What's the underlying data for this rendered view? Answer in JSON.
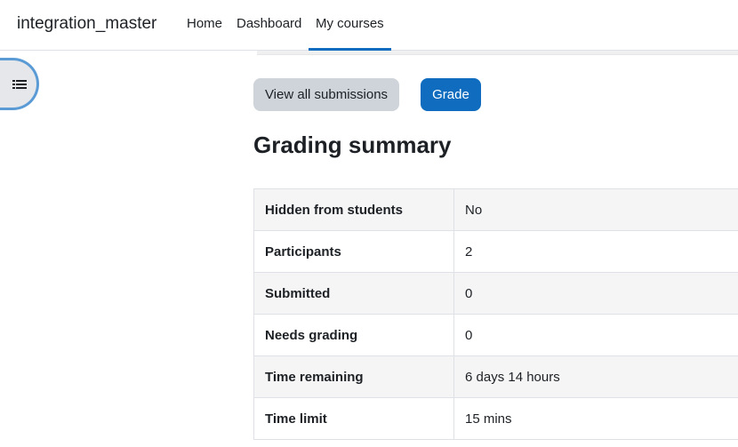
{
  "navbar": {
    "site_name": "integration_master",
    "items": [
      {
        "label": "Home"
      },
      {
        "label": "Dashboard"
      },
      {
        "label": "My courses",
        "active": true
      }
    ]
  },
  "drawer": {
    "icon": "list-icon"
  },
  "actions": {
    "view_all_label": "View all submissions",
    "grade_label": "Grade"
  },
  "summary": {
    "heading": "Grading summary",
    "rows": [
      {
        "label": "Hidden from students",
        "value": "No"
      },
      {
        "label": "Participants",
        "value": "2"
      },
      {
        "label": "Submitted",
        "value": "0"
      },
      {
        "label": "Needs grading",
        "value": "0"
      },
      {
        "label": "Time remaining",
        "value": "6 days 14 hours"
      },
      {
        "label": "Time limit",
        "value": "15 mins"
      }
    ]
  },
  "colors": {
    "primary": "#0f6cbf",
    "secondary": "#ced4da",
    "row_alt": "#f5f5f5",
    "text": "#1d2125"
  }
}
